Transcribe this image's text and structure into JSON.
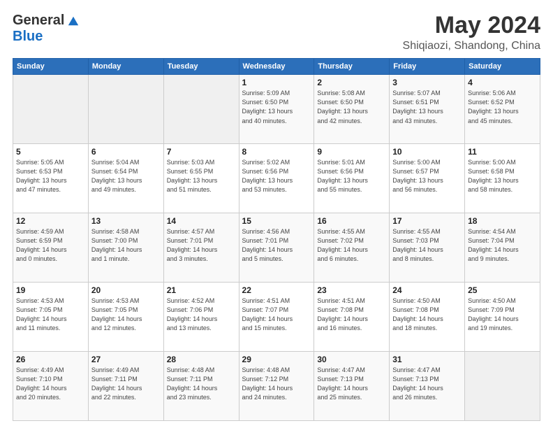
{
  "header": {
    "logo_general": "General",
    "logo_blue": "Blue",
    "month": "May 2024",
    "location": "Shiqiaozi, Shandong, China"
  },
  "days_of_week": [
    "Sunday",
    "Monday",
    "Tuesday",
    "Wednesday",
    "Thursday",
    "Friday",
    "Saturday"
  ],
  "weeks": [
    [
      {
        "num": "",
        "info": ""
      },
      {
        "num": "",
        "info": ""
      },
      {
        "num": "",
        "info": ""
      },
      {
        "num": "1",
        "info": "Sunrise: 5:09 AM\nSunset: 6:50 PM\nDaylight: 13 hours\nand 40 minutes."
      },
      {
        "num": "2",
        "info": "Sunrise: 5:08 AM\nSunset: 6:50 PM\nDaylight: 13 hours\nand 42 minutes."
      },
      {
        "num": "3",
        "info": "Sunrise: 5:07 AM\nSunset: 6:51 PM\nDaylight: 13 hours\nand 43 minutes."
      },
      {
        "num": "4",
        "info": "Sunrise: 5:06 AM\nSunset: 6:52 PM\nDaylight: 13 hours\nand 45 minutes."
      }
    ],
    [
      {
        "num": "5",
        "info": "Sunrise: 5:05 AM\nSunset: 6:53 PM\nDaylight: 13 hours\nand 47 minutes."
      },
      {
        "num": "6",
        "info": "Sunrise: 5:04 AM\nSunset: 6:54 PM\nDaylight: 13 hours\nand 49 minutes."
      },
      {
        "num": "7",
        "info": "Sunrise: 5:03 AM\nSunset: 6:55 PM\nDaylight: 13 hours\nand 51 minutes."
      },
      {
        "num": "8",
        "info": "Sunrise: 5:02 AM\nSunset: 6:56 PM\nDaylight: 13 hours\nand 53 minutes."
      },
      {
        "num": "9",
        "info": "Sunrise: 5:01 AM\nSunset: 6:56 PM\nDaylight: 13 hours\nand 55 minutes."
      },
      {
        "num": "10",
        "info": "Sunrise: 5:00 AM\nSunset: 6:57 PM\nDaylight: 13 hours\nand 56 minutes."
      },
      {
        "num": "11",
        "info": "Sunrise: 5:00 AM\nSunset: 6:58 PM\nDaylight: 13 hours\nand 58 minutes."
      }
    ],
    [
      {
        "num": "12",
        "info": "Sunrise: 4:59 AM\nSunset: 6:59 PM\nDaylight: 14 hours\nand 0 minutes."
      },
      {
        "num": "13",
        "info": "Sunrise: 4:58 AM\nSunset: 7:00 PM\nDaylight: 14 hours\nand 1 minute."
      },
      {
        "num": "14",
        "info": "Sunrise: 4:57 AM\nSunset: 7:01 PM\nDaylight: 14 hours\nand 3 minutes."
      },
      {
        "num": "15",
        "info": "Sunrise: 4:56 AM\nSunset: 7:01 PM\nDaylight: 14 hours\nand 5 minutes."
      },
      {
        "num": "16",
        "info": "Sunrise: 4:55 AM\nSunset: 7:02 PM\nDaylight: 14 hours\nand 6 minutes."
      },
      {
        "num": "17",
        "info": "Sunrise: 4:55 AM\nSunset: 7:03 PM\nDaylight: 14 hours\nand 8 minutes."
      },
      {
        "num": "18",
        "info": "Sunrise: 4:54 AM\nSunset: 7:04 PM\nDaylight: 14 hours\nand 9 minutes."
      }
    ],
    [
      {
        "num": "19",
        "info": "Sunrise: 4:53 AM\nSunset: 7:05 PM\nDaylight: 14 hours\nand 11 minutes."
      },
      {
        "num": "20",
        "info": "Sunrise: 4:53 AM\nSunset: 7:05 PM\nDaylight: 14 hours\nand 12 minutes."
      },
      {
        "num": "21",
        "info": "Sunrise: 4:52 AM\nSunset: 7:06 PM\nDaylight: 14 hours\nand 13 minutes."
      },
      {
        "num": "22",
        "info": "Sunrise: 4:51 AM\nSunset: 7:07 PM\nDaylight: 14 hours\nand 15 minutes."
      },
      {
        "num": "23",
        "info": "Sunrise: 4:51 AM\nSunset: 7:08 PM\nDaylight: 14 hours\nand 16 minutes."
      },
      {
        "num": "24",
        "info": "Sunrise: 4:50 AM\nSunset: 7:08 PM\nDaylight: 14 hours\nand 18 minutes."
      },
      {
        "num": "25",
        "info": "Sunrise: 4:50 AM\nSunset: 7:09 PM\nDaylight: 14 hours\nand 19 minutes."
      }
    ],
    [
      {
        "num": "26",
        "info": "Sunrise: 4:49 AM\nSunset: 7:10 PM\nDaylight: 14 hours\nand 20 minutes."
      },
      {
        "num": "27",
        "info": "Sunrise: 4:49 AM\nSunset: 7:11 PM\nDaylight: 14 hours\nand 22 minutes."
      },
      {
        "num": "28",
        "info": "Sunrise: 4:48 AM\nSunset: 7:11 PM\nDaylight: 14 hours\nand 23 minutes."
      },
      {
        "num": "29",
        "info": "Sunrise: 4:48 AM\nSunset: 7:12 PM\nDaylight: 14 hours\nand 24 minutes."
      },
      {
        "num": "30",
        "info": "Sunrise: 4:47 AM\nSunset: 7:13 PM\nDaylight: 14 hours\nand 25 minutes."
      },
      {
        "num": "31",
        "info": "Sunrise: 4:47 AM\nSunset: 7:13 PM\nDaylight: 14 hours\nand 26 minutes."
      },
      {
        "num": "",
        "info": ""
      }
    ]
  ]
}
